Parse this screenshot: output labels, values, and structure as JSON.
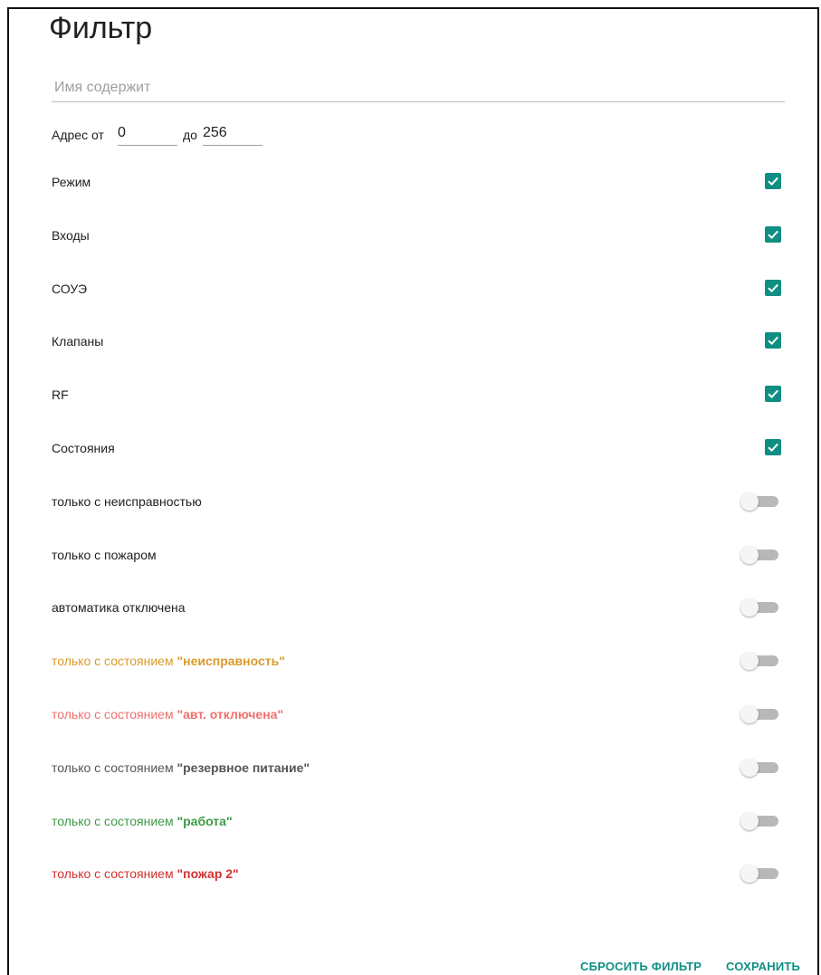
{
  "dialog": {
    "title": "Фильтр"
  },
  "name_filter": {
    "placeholder": "Имя содержит",
    "value": ""
  },
  "address": {
    "from_label": "Адрес от",
    "from_value": "0",
    "to_label": "до",
    "to_value": "256"
  },
  "checkbox_rows": [
    {
      "label": "Режим",
      "checked": true
    },
    {
      "label": "Входы",
      "checked": true
    },
    {
      "label": "СОУЭ",
      "checked": true
    },
    {
      "label": "Клапаны",
      "checked": true
    },
    {
      "label": "RF",
      "checked": true
    },
    {
      "label": "Состояния",
      "checked": true
    }
  ],
  "toggle_rows": [
    {
      "prefix": "только с неисправностью",
      "quoted": "",
      "color": "#212121",
      "on": false
    },
    {
      "prefix": "только с пожаром",
      "quoted": "",
      "color": "#212121",
      "on": false
    },
    {
      "prefix": "автоматика отключена",
      "quoted": "",
      "color": "#212121",
      "on": false
    },
    {
      "prefix": "только с состоянием ",
      "quoted": "\"неисправность\"",
      "color": "#d99a2b",
      "on": false
    },
    {
      "prefix": "только с состоянием ",
      "quoted": "\"авт. отключена\"",
      "color": "#ef6f6f",
      "on": false
    },
    {
      "prefix": "только с состоянием ",
      "quoted": "\"резервное питание\"",
      "color": "#555555",
      "on": false
    },
    {
      "prefix": "только с состоянием ",
      "quoted": "\"работа\"",
      "color": "#3f9a45",
      "on": false
    },
    {
      "prefix": "только с состоянием ",
      "quoted": "\"пожар 2\"",
      "color": "#d32f2f",
      "on": false
    }
  ],
  "actions": {
    "reset_label": "СБРОСИТЬ ФИЛЬТР",
    "save_label": "СОХРАНИТЬ"
  },
  "colors": {
    "accent": "#0f8f83",
    "switch_off_track": "#b8b8b8",
    "switch_off_thumb": "#f5f5f5"
  }
}
